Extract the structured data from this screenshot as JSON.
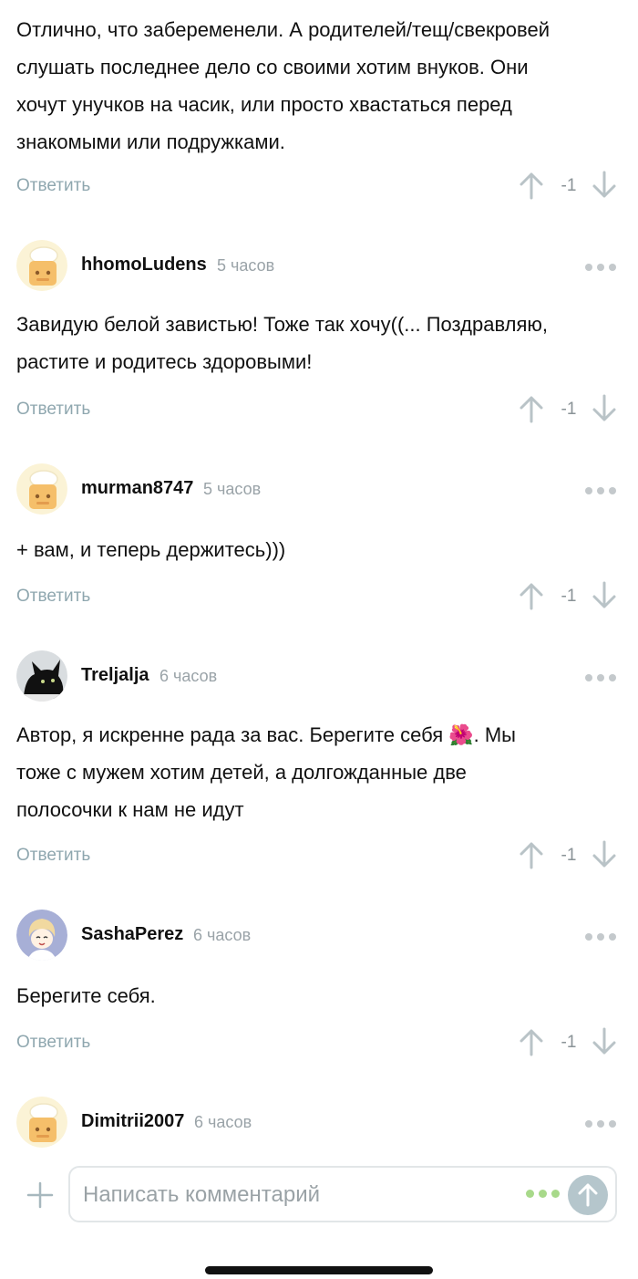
{
  "first_comment": {
    "text_lines": [
      "Отлично, что забеременели. А родителей/тещ/свекровей",
      "слушать последнее дело со своими хотим внуков. Они",
      "хочут унучков на часик, или просто хвастаться перед",
      "знакомыми или подружками."
    ],
    "reply_label": "Ответить",
    "score": "-1"
  },
  "comments": [
    {
      "username": "hhomoLudens",
      "time": "5 часов",
      "avatar": "chef-cookie-avatar",
      "text_lines": [
        "Завидую белой завистью! Тоже так хочу((... Поздравляю,",
        "растите и родитесь здоровыми!"
      ],
      "reply_label": "Ответить",
      "score": "-1"
    },
    {
      "username": "murman8747",
      "time": "5 часов",
      "avatar": "chef-cookie-avatar",
      "text_lines": [
        "+ вам, и теперь держитесь)))"
      ],
      "reply_label": "Ответить",
      "score": "-1"
    },
    {
      "username": "Treljalja",
      "time": "6 часов",
      "avatar": "black-cat-avatar",
      "text_lines": [
        "Автор, я искренне рада за вас. Берегите себя 🌺. Мы",
        "тоже с мужем хотим детей, а долгожданные две",
        "полосочки к нам не идут"
      ],
      "reply_label": "Ответить",
      "score": "-1"
    },
    {
      "username": "SashaPerez",
      "time": "6 часов",
      "avatar": "anime-character-avatar",
      "text_lines": [
        "Берегите себя."
      ],
      "reply_label": "Ответить",
      "score": "-1"
    },
    {
      "username": "Dimitrii2007",
      "time": "6 часов",
      "avatar": "chef-cookie-avatar"
    }
  ],
  "input": {
    "placeholder": "Написать комментарий"
  },
  "colors": {
    "reply": "#8fa7af",
    "time": "#9aa3a8",
    "send_button": "#b5c6cc",
    "emoji_dots": "#a8d98a"
  }
}
